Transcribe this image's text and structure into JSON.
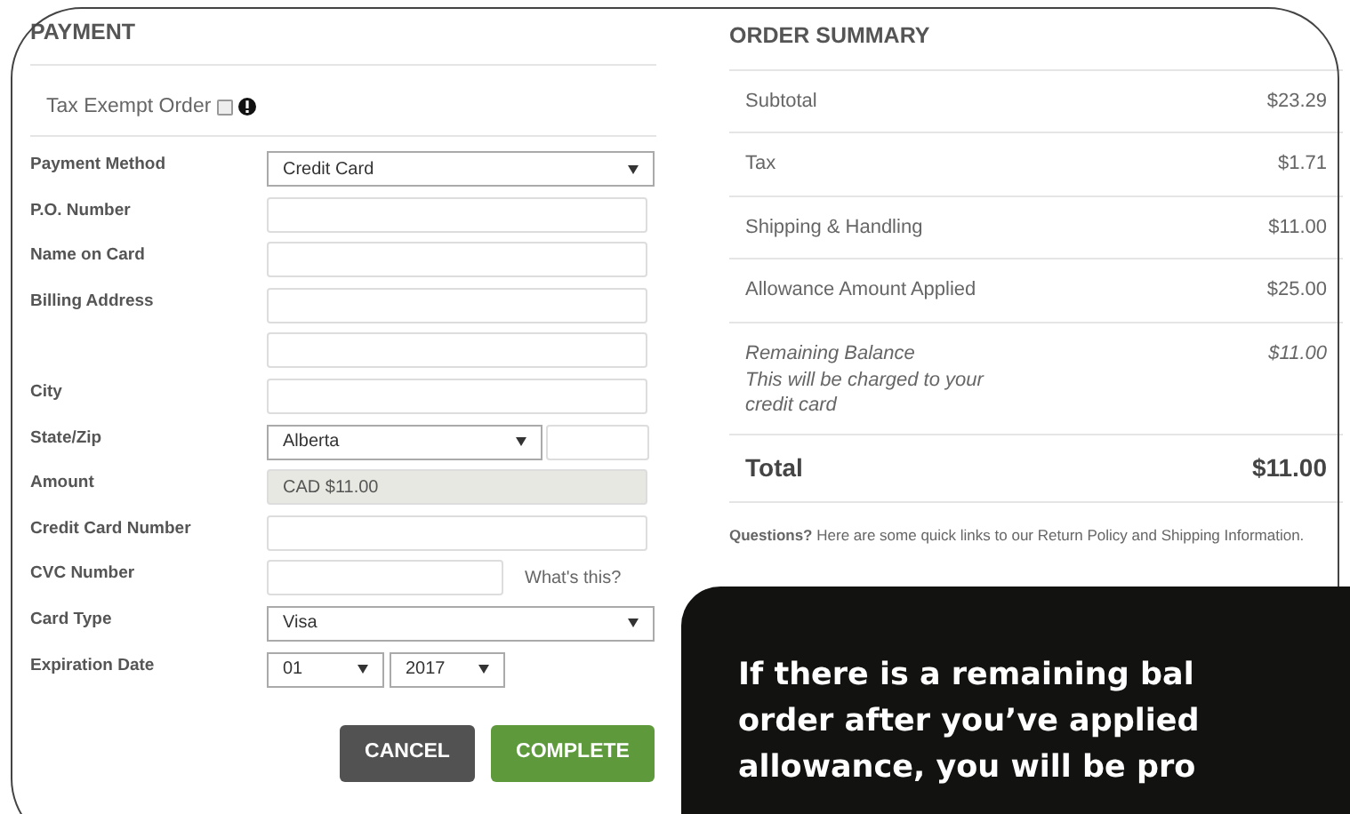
{
  "payment": {
    "title": "PAYMENT",
    "tax_exempt": {
      "label": "Tax Exempt Order",
      "checked": false
    },
    "fields": [
      {
        "kind": "select",
        "label": "Payment Method",
        "value": "Credit Card"
      },
      {
        "kind": "input",
        "label": "P.O. Number"
      },
      {
        "kind": "input",
        "label": "Name on Card"
      },
      {
        "kind": "input",
        "label": "Billing Address"
      },
      {
        "kind": "input"
      },
      {
        "kind": "input",
        "label": "City"
      },
      {
        "kind": "select_input",
        "label": "State/Zip",
        "value": "Alberta"
      },
      {
        "kind": "readonly",
        "label": "Amount",
        "value": "CAD $11.00"
      },
      {
        "kind": "input",
        "label": "Credit Card Number"
      },
      {
        "kind": "input_link",
        "label": "CVC Number",
        "link": "What's this?"
      },
      {
        "kind": "select",
        "label": "Card Type",
        "value": "Visa"
      },
      {
        "kind": "two_selects",
        "label": "Expiration Date",
        "value": "01",
        "value2": "2017"
      }
    ],
    "buttons": [
      {
        "kind": "cancel",
        "label": "CANCEL"
      },
      {
        "kind": "complete",
        "label": "COMPLETE"
      }
    ]
  },
  "order_summary": {
    "title": "ORDER SUMMARY",
    "rows": [
      {
        "kind": "normal",
        "label": "Subtotal",
        "value": "$23.29"
      },
      {
        "kind": "normal",
        "label": "Tax",
        "value": "$1.71"
      },
      {
        "kind": "normal",
        "label": "Shipping & Handling",
        "value": "$11.00"
      },
      {
        "kind": "normal",
        "label": "Allowance Amount Applied",
        "value": "$25.00"
      },
      {
        "kind": "italic",
        "label": "Remaining Balance",
        "note": "This will be charged to your credit card",
        "value": "$11.00"
      },
      {
        "kind": "total",
        "label": "Total",
        "value": "$11.00"
      }
    ],
    "questions": "**Questions?** Here are some quick links to our Return Policy and Shipping Information."
  },
  "callout": {
    "lines": [
      "If there is a remaining bal",
      "order after you’ve applied",
      "allowance, you will be pro"
    ]
  }
}
